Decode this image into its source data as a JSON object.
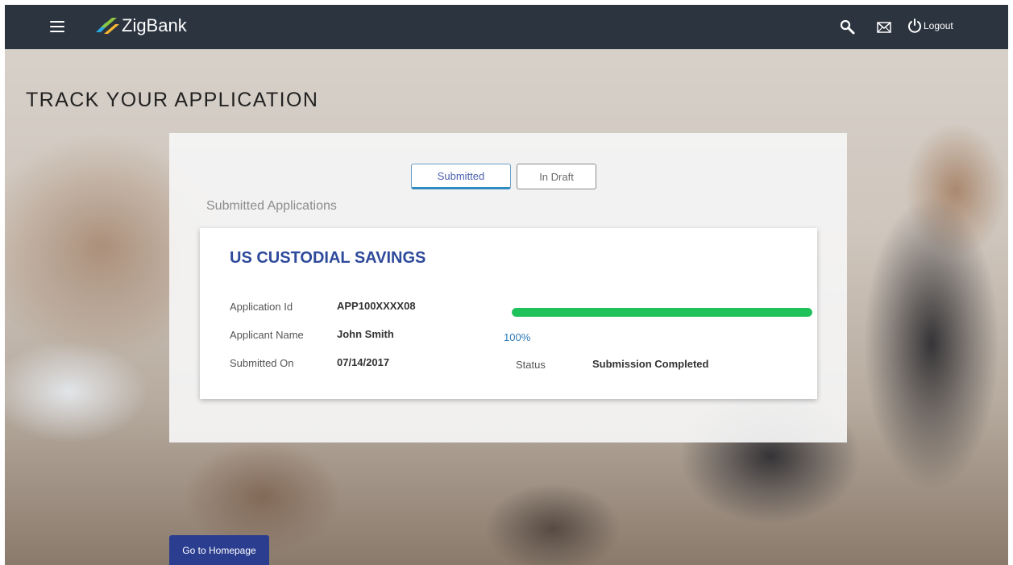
{
  "header": {
    "brand": "ZigBank",
    "logout_label": "Logout",
    "bar_color": "#2c3440"
  },
  "icons": {
    "menu": "hamburger-menu-icon",
    "search": "search-icon",
    "mail": "mail-icon",
    "logout": "power-icon"
  },
  "page": {
    "title": "TRACK YOUR APPLICATION"
  },
  "tabs": [
    {
      "label": "Submitted",
      "active": true
    },
    {
      "label": "In Draft",
      "active": false
    }
  ],
  "section": {
    "heading": "Submitted Applications"
  },
  "application": {
    "title": "US CUSTODIAL SAVINGS",
    "fields": [
      {
        "label": "Application Id",
        "value": "APP100XXXX08"
      },
      {
        "label": "Applicant Name",
        "value": "John Smith"
      },
      {
        "label": "Submitted On",
        "value": "07/14/2017"
      }
    ],
    "progress_percent": 100,
    "progress_label": "100%",
    "status_label": "Status",
    "status_value": "Submission Completed",
    "progress_color": "#1fc15a"
  },
  "footer": {
    "home_label": "Go to Homepage",
    "button_color": "#2b3d8f"
  }
}
